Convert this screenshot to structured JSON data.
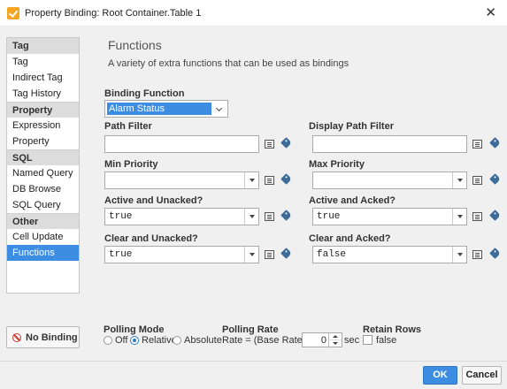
{
  "window": {
    "title": "Property Binding: Root Container.Table 1"
  },
  "sidebar": {
    "groups": [
      {
        "category": "Tag",
        "items": [
          "Tag",
          "Indirect Tag",
          "Tag History"
        ]
      },
      {
        "category": "Property",
        "items": [
          "Expression",
          "Property"
        ]
      },
      {
        "category": "SQL",
        "items": [
          "Named Query",
          "DB Browse",
          "SQL Query"
        ]
      },
      {
        "category": "Other",
        "items": [
          "Cell Update",
          "Functions"
        ]
      }
    ],
    "selected": "Functions",
    "no_binding_label": "No Binding"
  },
  "panel": {
    "title": "Functions",
    "subtitle": "A variety of extra functions that can be used as bindings"
  },
  "binding_function": {
    "label": "Binding Function",
    "value": "Alarm Status"
  },
  "fields": {
    "path_filter": {
      "label": "Path Filter",
      "value": ""
    },
    "display_path_filter": {
      "label": "Display Path Filter",
      "value": ""
    },
    "min_priority": {
      "label": "Min Priority",
      "value": ""
    },
    "max_priority": {
      "label": "Max Priority",
      "value": ""
    },
    "active_unacked": {
      "label": "Active and Unacked?",
      "value": "true"
    },
    "active_acked": {
      "label": "Active and Acked?",
      "value": "true"
    },
    "clear_unacked": {
      "label": "Clear and Unacked?",
      "value": "true"
    },
    "clear_acked": {
      "label": "Clear and Acked?",
      "value": "false"
    }
  },
  "polling": {
    "mode_label": "Polling Mode",
    "options": [
      "Off",
      "Relative",
      "Absolute"
    ],
    "selected": "Relative",
    "rate_label": "Polling Rate",
    "rate_prefix": "Rate = (Base Rate) +/-",
    "rate_value": "0",
    "rate_suffix": "sec",
    "retain_label": "Retain Rows",
    "retain_value": "false"
  },
  "buttons": {
    "ok": "OK",
    "cancel": "Cancel"
  },
  "colors": {
    "accent": "#3d8ee2",
    "no_binding": "#cf3a2e"
  }
}
